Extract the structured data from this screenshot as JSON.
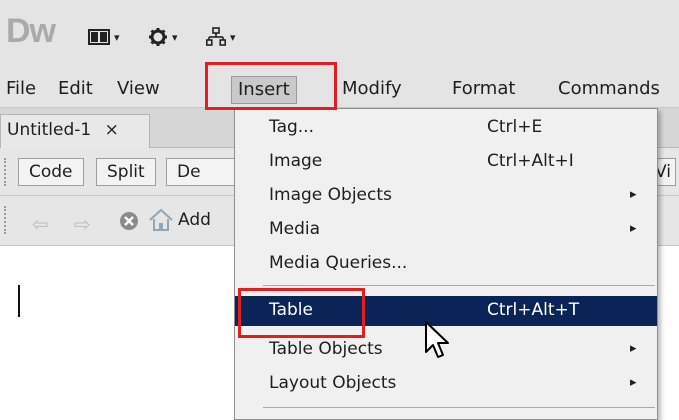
{
  "app": {
    "logo": "Dw"
  },
  "toolbar": {
    "buttons": [
      {
        "icon": "layout-icon"
      },
      {
        "icon": "gear-icon"
      },
      {
        "icon": "site-icon"
      }
    ],
    "arrow": "▾"
  },
  "menubar": {
    "items": [
      "File",
      "Edit",
      "View",
      "Insert",
      "Modify",
      "Format",
      "Commands"
    ]
  },
  "document_tab": {
    "name": "Untitled-1",
    "close": "×"
  },
  "view_buttons": [
    "Code",
    "Split",
    "De"
  ],
  "right_button": "Vi",
  "address_label": "Add",
  "insert_menu": {
    "items": [
      {
        "label": "Tag...",
        "shortcut": "Ctrl+E"
      },
      {
        "label": "Image",
        "shortcut": "Ctrl+Alt+I"
      },
      {
        "label": "Image Objects",
        "submenu": true
      },
      {
        "label": "Media",
        "submenu": true
      },
      {
        "label": "Media Queries..."
      },
      {
        "label": "Table",
        "shortcut": "Ctrl+Alt+T",
        "highlighted": true
      },
      {
        "label": "Table Objects",
        "submenu": true
      },
      {
        "label": "Layout Objects",
        "submenu": true
      }
    ],
    "submenu_arrow": "▸"
  },
  "colors": {
    "highlight": "#0a2457",
    "annotation": "#e02020"
  }
}
